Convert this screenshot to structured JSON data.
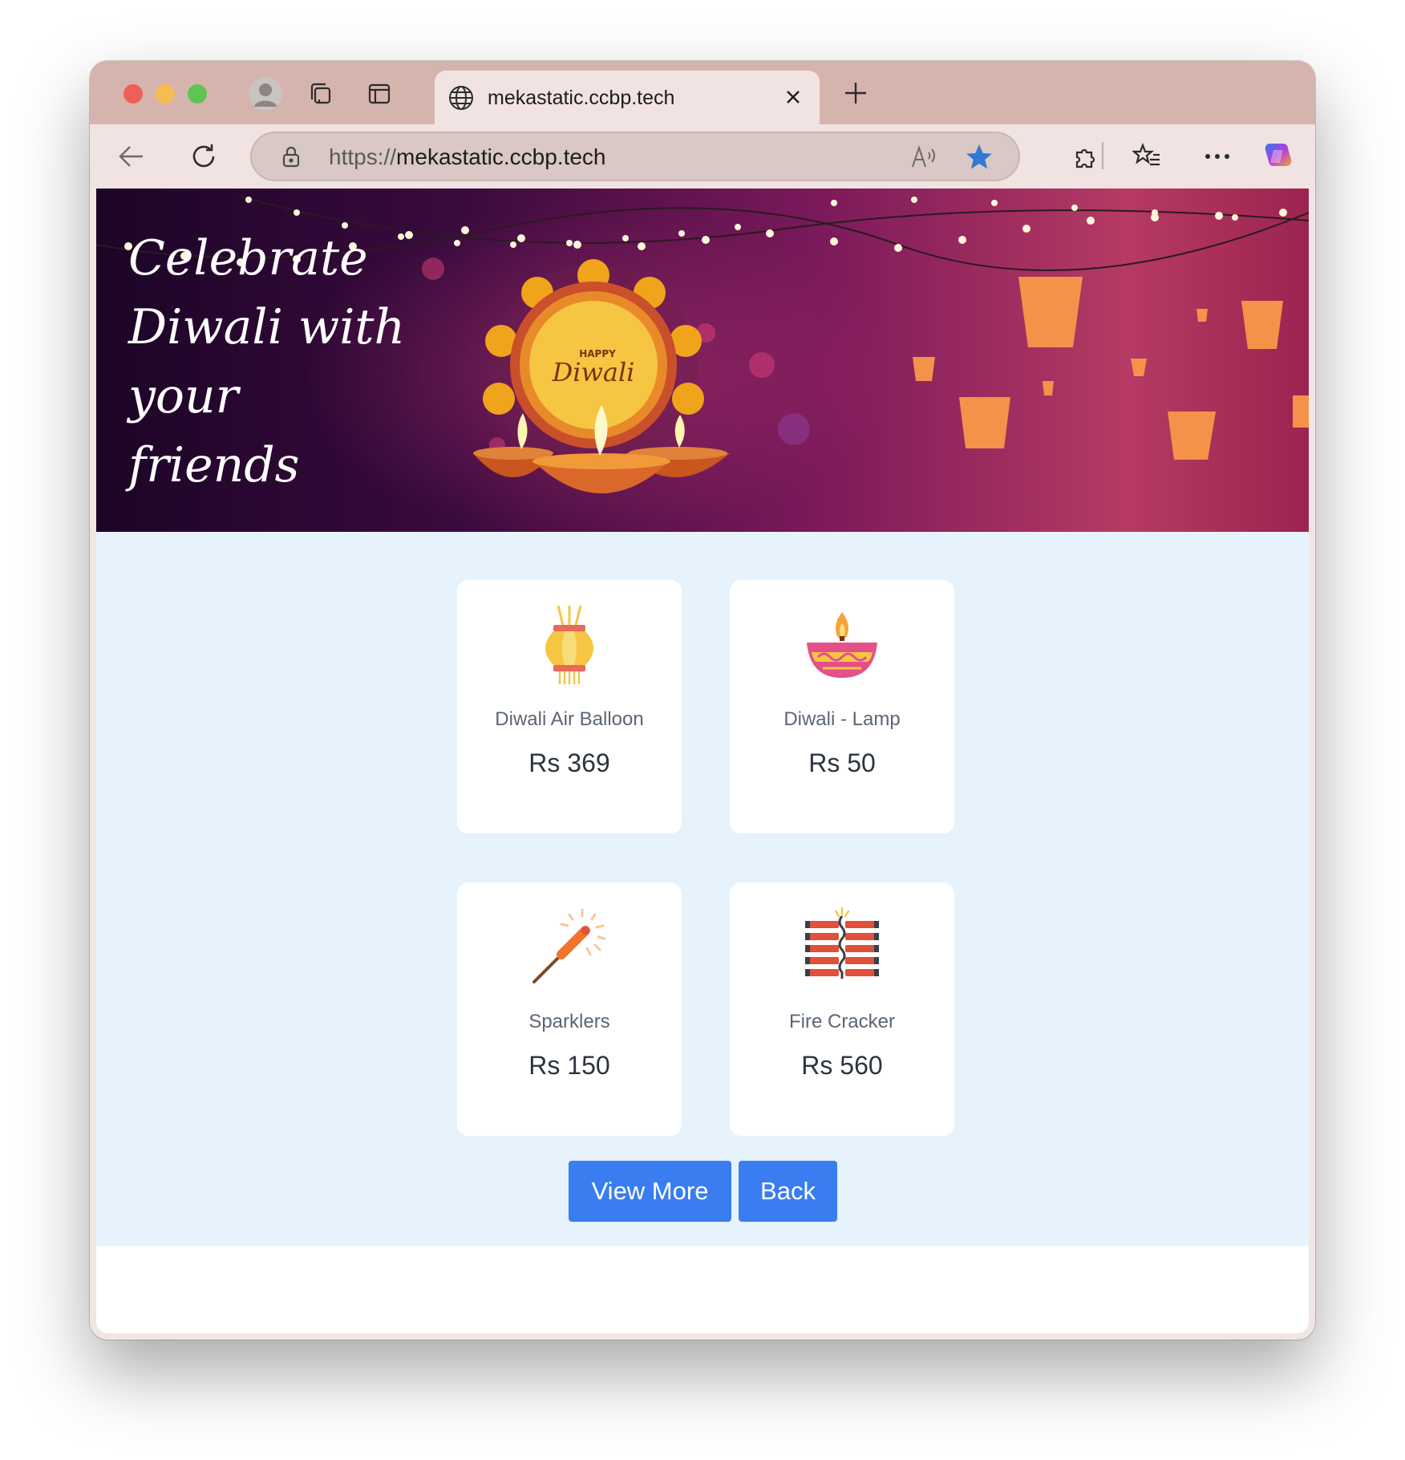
{
  "browser": {
    "tab_title": "mekastatic.ccbp.tech",
    "url_scheme": "https://",
    "url_host": "mekastatic.ccbp.tech"
  },
  "hero": {
    "title": "Celebrate\nDiwali with\nyour friends",
    "badge_small": "HAPPY",
    "badge_big": "Diwali"
  },
  "products": [
    {
      "name": "Diwali Air Balloon",
      "price": "Rs 369",
      "icon": "air-balloon-icon"
    },
    {
      "name": "Diwali - Lamp",
      "price": "Rs 50",
      "icon": "diya-lamp-icon"
    },
    {
      "name": "Sparklers",
      "price": "Rs 150",
      "icon": "sparkler-icon"
    },
    {
      "name": "Fire Cracker",
      "price": "Rs 560",
      "icon": "fire-cracker-icon"
    }
  ],
  "actions": {
    "view_more": "View More",
    "back": "Back"
  },
  "colors": {
    "content_bg": "#e6f3fd",
    "button": "#3a7df1",
    "titlebar": "#d6b4ae"
  }
}
